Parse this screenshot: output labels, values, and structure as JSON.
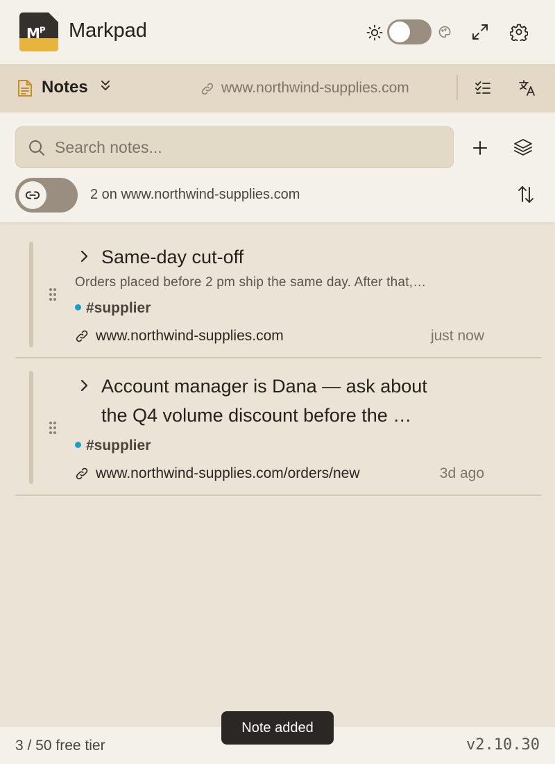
{
  "app": {
    "title": "Markpad",
    "logo_mark": "M",
    "logo_sup": "P"
  },
  "header": {
    "icons": [
      "sun-icon",
      "theme-toggle",
      "palette-icon",
      "expand-icon",
      "gear-icon"
    ]
  },
  "notes_bar": {
    "title": "Notes",
    "site": "www.northwind-supplies.com"
  },
  "search": {
    "placeholder": "Search notes...",
    "value": ""
  },
  "filter": {
    "site_count_text": "2 on www.northwind-supplies.com"
  },
  "notes": [
    {
      "title": "Same-day cut-off",
      "excerpt": "Orders placed before 2 pm ship the same day. After that,…",
      "tag": "#supplier",
      "url": "www.northwind-supplies.com",
      "time": "just now"
    },
    {
      "title_line1": "Account manager is Dana — ask about",
      "title_line2": "the Q4 volume discount before the …",
      "tag": "#supplier",
      "url": "www.northwind-supplies.com/orders/new",
      "time": "3d ago"
    }
  ],
  "footer": {
    "tier": "3 / 50 free tier",
    "version": "v2.10.30"
  },
  "toast": {
    "text": "Note added"
  },
  "colors": {
    "accent_yellow": "#e7b43c",
    "tag_dot": "#1a9fc4",
    "toggle": "#9a8e80"
  }
}
